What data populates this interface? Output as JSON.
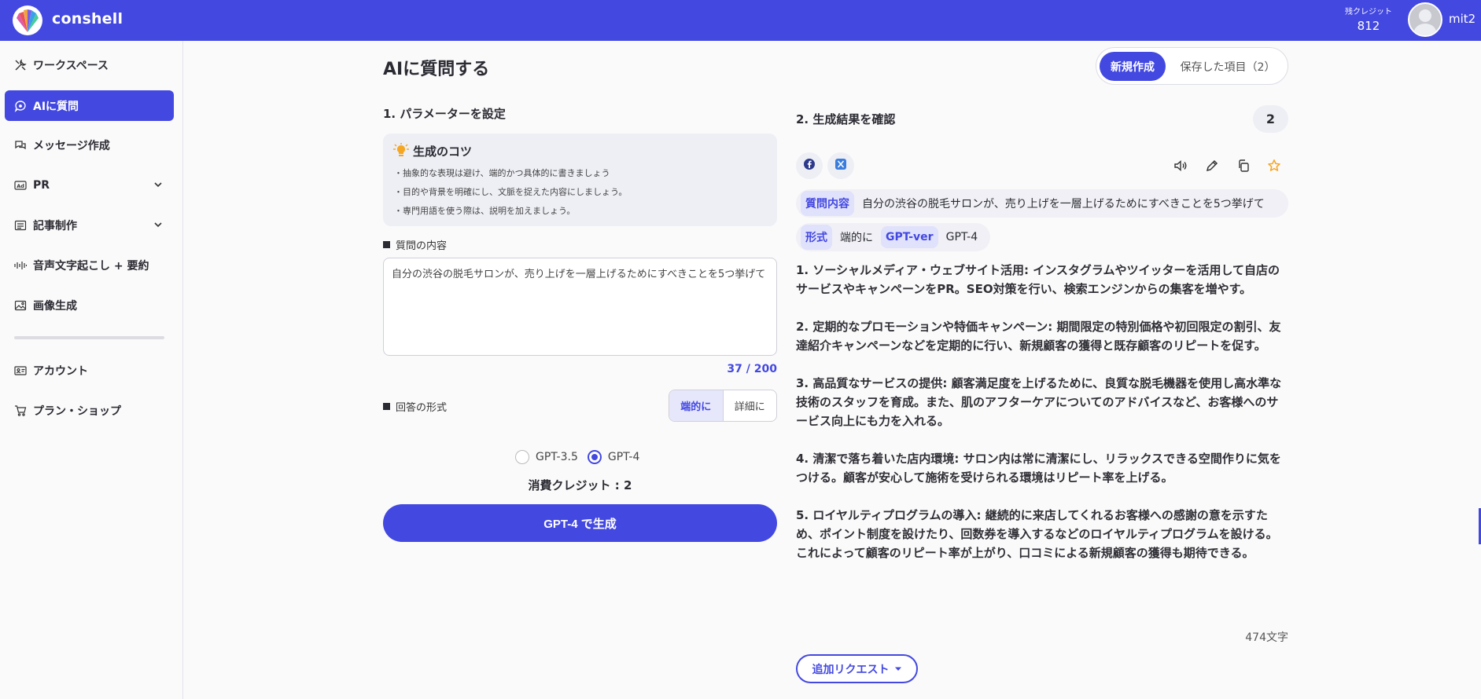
{
  "app": {
    "brand": "conshell",
    "credit_label": "残クレジット",
    "credit_value": "812",
    "username": "mit2",
    "accent": "#4348e0"
  },
  "sidebar": {
    "items": [
      {
        "label": "ワークスペース",
        "icon": "tools-icon"
      },
      {
        "label": "AIに質問",
        "icon": "chat-bubble-icon"
      },
      {
        "label": "メッセージ作成",
        "icon": "chat-bubbles-icon"
      },
      {
        "label": "PR",
        "icon": "ad-icon"
      },
      {
        "label": "記事制作",
        "icon": "article-icon"
      },
      {
        "label": "音声文字起こし + 要約",
        "icon": "audio-icon"
      },
      {
        "label": "画像生成",
        "icon": "image-icon"
      },
      {
        "label": "アカウント",
        "icon": "id-card-icon"
      },
      {
        "label": "プラン・ショップ",
        "icon": "cart-icon"
      }
    ]
  },
  "page": {
    "title": "AIに質問する",
    "tab_new": "新規作成",
    "tab_saved": "保存した項目（2）"
  },
  "params": {
    "heading": "1. パラメーターを設定",
    "tips_title": "生成のコツ",
    "tips": [
      "・抽象的な表現は避け、端的かつ具体的に書きましょう",
      "・目的や背景を明確にし、文脈を捉えた内容にしましょう。",
      "・専門用語を使う際は、説明を加えましょう。"
    ],
    "question_label": "質問の内容",
    "question_value": "自分の渋谷の脱毛サロンが、売り上げを一層上げるためにすべきことを5つ挙げて",
    "counter": "37 / 200",
    "format_label": "回答の形式",
    "format_options": [
      "端的に",
      "詳細に"
    ],
    "model_options": [
      "GPT-3.5",
      "GPT-4"
    ],
    "selected_model": "GPT-4",
    "cost": "消費クレジット : 2",
    "generate_button": "GPT-4 で生成"
  },
  "result": {
    "heading": "2. 生成結果を確認",
    "count": "2",
    "question_tag": "質問内容",
    "question_text": "自分の渋谷の脱毛サロンが、売り上げを一層上げるためにすべきことを5つ挙げて",
    "format_tag": "形式",
    "format_value": "端的に",
    "model_tag": "GPT-ver",
    "model_value": "GPT-4",
    "answer": [
      "1. ソーシャルメディア・ウェブサイト活用: インスタグラムやツイッターを活用して自店のサービスやキャンペーンをPR。SEO対策を行い、検索エンジンからの集客を増やす。",
      "2. 定期的なプロモーションや特価キャンペーン: 期間限定の特別価格や初回限定の割引、友達紹介キャンペーンなどを定期的に行い、新規顧客の獲得と既存顧客のリピートを促す。",
      "3. 高品質なサービスの提供: 顧客満足度を上げるために、良質な脱毛機器を使用し高水準な技術のスタッフを育成。また、肌のアフターケアについてのアドバイスなど、お客様へのサービス向上にも力を入れる。",
      "4. 清潔で落ち着いた店内環境: サロン内は常に清潔にし、リラックスできる空間作りに気をつける。顧客が安心して施術を受けられる環境はリピート率を上げる。",
      "5. ロイヤルティプログラムの導入: 継続的に来店してくれるお客様への感謝の意を示すため、ポイント制度を設けたり、回数券を導入するなどのロイヤルティプログラムを設ける。これによって顧客のリピート率が上がり、口コミによる新規顧客の獲得も期待できる。"
    ],
    "char_count": "474文字",
    "more_button": "追加リクエスト"
  }
}
